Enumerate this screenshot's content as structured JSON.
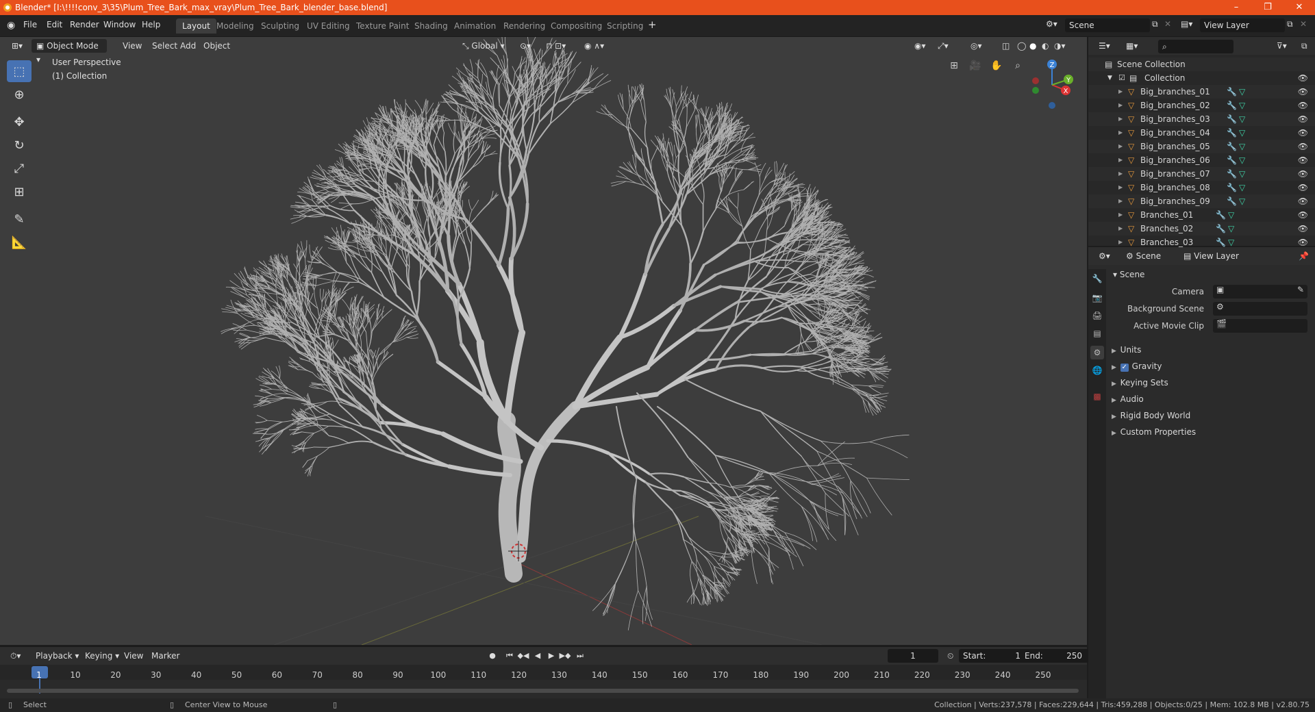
{
  "window": {
    "title": "Blender* [I:\\!!!!conv_3\\35\\Plum_Tree_Bark_max_vray\\Plum_Tree_Bark_blender_base.blend]"
  },
  "menu": [
    "File",
    "Edit",
    "Render",
    "Window",
    "Help"
  ],
  "workspaces": [
    "Layout",
    "Modeling",
    "Sculpting",
    "UV Editing",
    "Texture Paint",
    "Shading",
    "Animation",
    "Rendering",
    "Compositing",
    "Scripting"
  ],
  "active_workspace": "Layout",
  "scene_field": "Scene",
  "viewlayer_field": "View Layer",
  "viewport": {
    "mode": "Object Mode",
    "menus": [
      "View",
      "Select",
      "Add",
      "Object"
    ],
    "orientation": "Global",
    "perspective_label": "User Perspective",
    "collection_label": "(1) Collection",
    "gizmo": {
      "x": "X",
      "y": "Y",
      "z": "Z"
    }
  },
  "timeline": {
    "menus": [
      "Playback",
      "Keying",
      "View",
      "Marker"
    ],
    "current_frame": "1",
    "start_label": "Start:",
    "start": "1",
    "end_label": "End:",
    "end": "250",
    "ticks": [
      "1",
      "10",
      "20",
      "30",
      "40",
      "50",
      "60",
      "70",
      "80",
      "90",
      "100",
      "110",
      "120",
      "130",
      "140",
      "150",
      "160",
      "170",
      "180",
      "190",
      "200",
      "210",
      "220",
      "230",
      "240",
      "250"
    ]
  },
  "statusbar": {
    "left_hint": "Select",
    "mid_hint": "Center View to Mouse",
    "stats": "Collection | Verts:237,578 | Faces:229,644 | Tris:459,288 | Objects:0/25 | Mem: 102.8 MB | v2.80.75"
  },
  "outliner": {
    "root": "Scene Collection",
    "collection": "Collection",
    "items": [
      "Big_branches_01",
      "Big_branches_02",
      "Big_branches_03",
      "Big_branches_04",
      "Big_branches_05",
      "Big_branches_06",
      "Big_branches_07",
      "Big_branches_08",
      "Big_branches_09",
      "Branches_01",
      "Branches_02",
      "Branches_03"
    ]
  },
  "properties": {
    "tab_scene": "Scene",
    "tab_viewlayer": "View Layer",
    "section": "Scene",
    "fields": [
      {
        "label": "Camera"
      },
      {
        "label": "Background Scene"
      },
      {
        "label": "Active Movie Clip"
      }
    ],
    "subsections": [
      "Units",
      "Gravity",
      "Keying Sets",
      "Audio",
      "Rigid Body World",
      "Custom Properties"
    ]
  }
}
